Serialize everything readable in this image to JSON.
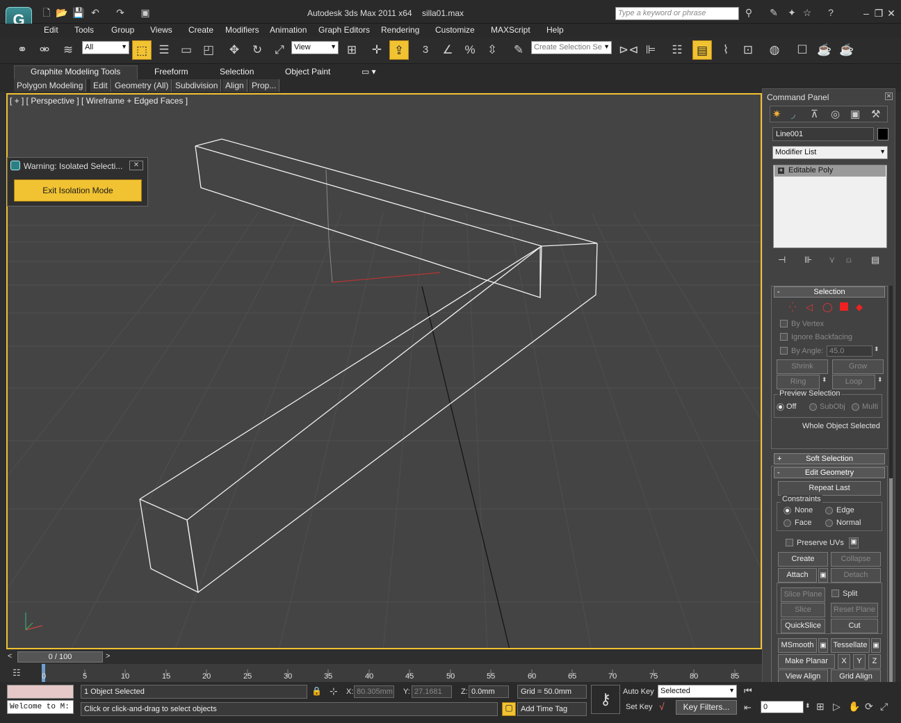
{
  "app": {
    "title": "Autodesk 3ds Max  2011 x64",
    "file": "silla01.max",
    "search_placeholder": "Type a keyword or phrase",
    "logo": "3ds-max-logo"
  },
  "menu": [
    "Edit",
    "Tools",
    "Group",
    "Views",
    "Create",
    "Modifiers",
    "Animation",
    "Graph Editors",
    "Rendering",
    "Customize",
    "MAXScript",
    "Help"
  ],
  "toolbar": {
    "selection_filter": "All",
    "ref_coord": "View",
    "named_selection": "Create Selection Se",
    "snap_label": "3"
  },
  "graphite": {
    "tabs": [
      "Graphite Modeling Tools",
      "Freeform",
      "Selection",
      "Object Paint"
    ],
    "subtabs": [
      "Polygon Modeling",
      "Edit",
      "Geometry (All)",
      "Subdivision",
      "Align",
      "Prop..."
    ]
  },
  "viewport": {
    "label": "[ + ] [ Perspective ] [ Wireframe + Edged Faces ]",
    "accent": "#f1c232",
    "axis": {
      "x": "x",
      "y": "y",
      "z": "z"
    }
  },
  "warning": {
    "title": "Warning: Isolated Selecti...",
    "button": "Exit Isolation Mode"
  },
  "command_panel": {
    "title": "Command Panel",
    "object_name": "Line001",
    "modifier_list": "Modifier List",
    "stack_item": "Editable Poly",
    "selection": {
      "header": "Selection",
      "by_vertex": "By Vertex",
      "ignore_backfacing": "Ignore Backfacing",
      "by_angle": "By Angle:",
      "angle_value": "45.0",
      "shrink": "Shrink",
      "grow": "Grow",
      "ring": "Ring",
      "loop": "Loop",
      "preview_group": "Preview Selection",
      "preview_off": "Off",
      "preview_subobj": "SubObj",
      "preview_multi": "Multi",
      "status": "Whole Object Selected"
    },
    "soft_selection": "Soft Selection",
    "edit_geometry": {
      "header": "Edit Geometry",
      "repeat_last": "Repeat Last",
      "constraints": "Constraints",
      "none": "None",
      "edge": "Edge",
      "face": "Face",
      "normal": "Normal",
      "preserve_uvs": "Preserve UVs",
      "create": "Create",
      "collapse": "Collapse",
      "attach": "Attach",
      "detach": "Detach",
      "slice_plane": "Slice Plane",
      "split": "Split",
      "slice": "Slice",
      "reset_plane": "Reset Plane",
      "quickslice": "QuickSlice",
      "cut": "Cut",
      "msmooth": "MSmooth",
      "tessellate": "Tessellate",
      "make_planar": "Make Planar",
      "x": "X",
      "y": "Y",
      "z": "Z",
      "view_align": "View Align",
      "grid_align": "Grid Align"
    }
  },
  "timeline": {
    "slider": "0 / 100",
    "ticks": [
      "0",
      "5",
      "10",
      "15",
      "20",
      "25",
      "30",
      "35",
      "40",
      "45",
      "50",
      "55",
      "60",
      "65",
      "70",
      "75",
      "80",
      "85"
    ]
  },
  "status": {
    "welcome": "Welcome to M:",
    "objects_selected": "1 Object Selected",
    "prompt": "Click or click-and-drag to select objects",
    "x_label": "X:",
    "x_value": "80.305mm",
    "y_label": "Y:",
    "y_value": "27.1681",
    "z_label": "Z:",
    "z_value": "0.0mm",
    "grid": "Grid = 50.0mm",
    "add_time_tag": "Add Time Tag",
    "auto_key": "Auto Key",
    "set_key": "Set Key",
    "selected": "Selected",
    "key_filters": "Key Filters...",
    "frame": "0"
  }
}
